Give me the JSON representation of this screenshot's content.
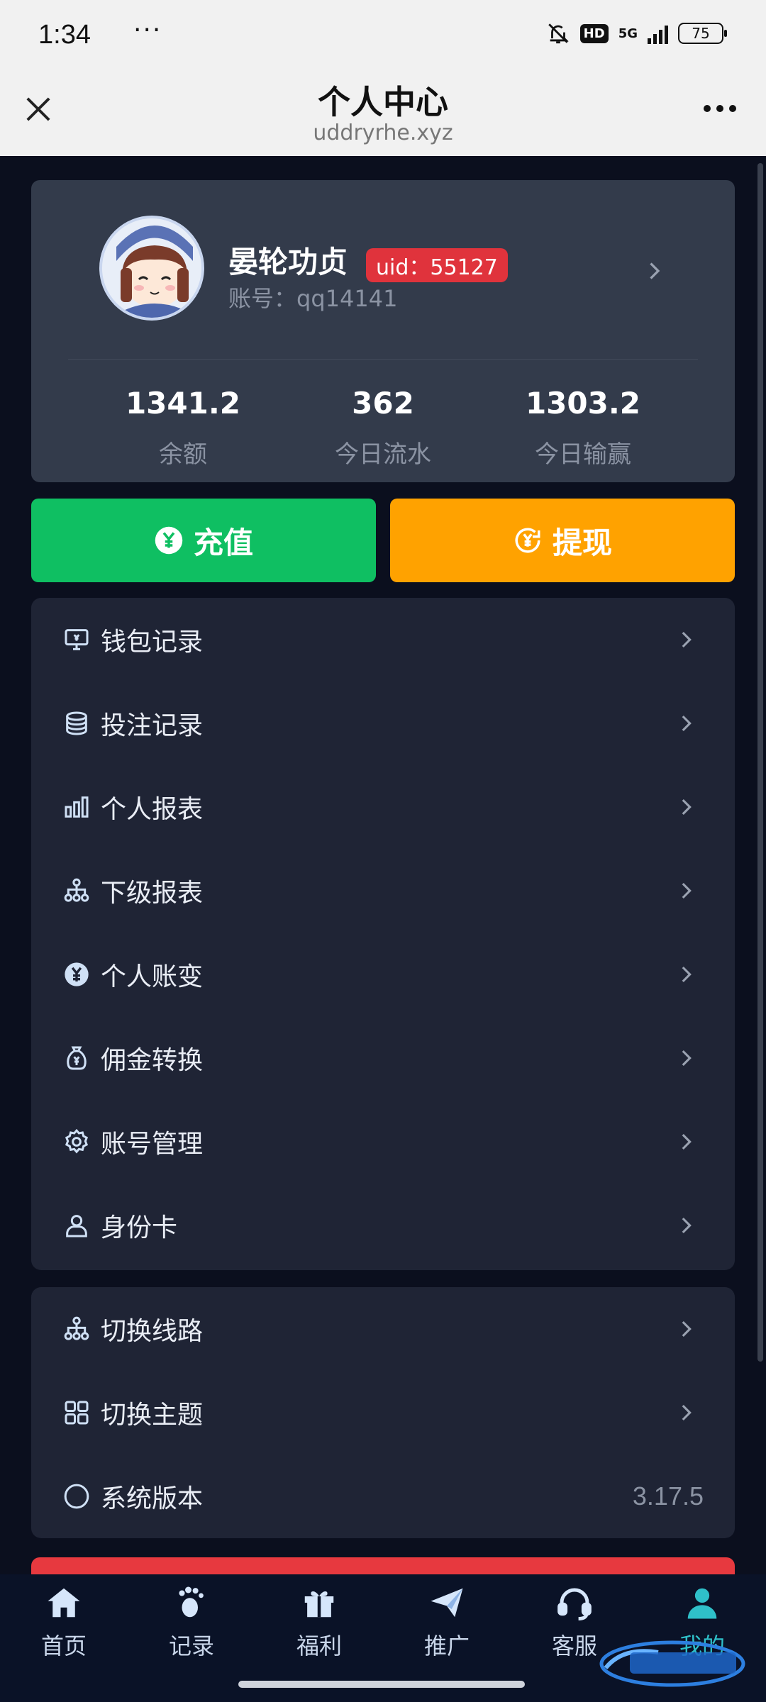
{
  "status_bar": {
    "time": "1:34",
    "dots": "···",
    "network": "5G",
    "battery": "75"
  },
  "header": {
    "title": "个人中心",
    "url": "uddryrhe.xyz"
  },
  "profile": {
    "name": "晏轮功贞",
    "uid_label": "uid：55127",
    "account_label": "账号：qq14141",
    "stats": [
      {
        "value": "1341.2",
        "label": "余额"
      },
      {
        "value": "362",
        "label": "今日流水"
      },
      {
        "value": "1303.2",
        "label": "今日输赢"
      }
    ]
  },
  "actions": {
    "recharge": "充值",
    "withdraw": "提现"
  },
  "menu_main": [
    {
      "label": "钱包记录",
      "icon": "wallet-monitor-icon"
    },
    {
      "label": "投注记录",
      "icon": "coin-stack-icon"
    },
    {
      "label": "个人报表",
      "icon": "bar-chart-icon"
    },
    {
      "label": "下级报表",
      "icon": "hierarchy-icon"
    },
    {
      "label": "个人账变",
      "icon": "yen-circle-icon"
    },
    {
      "label": "佣金转换",
      "icon": "money-bag-icon"
    },
    {
      "label": "账号管理",
      "icon": "gear-icon"
    },
    {
      "label": "身份卡",
      "icon": "user-icon"
    }
  ],
  "menu_system": [
    {
      "label": "切换线路",
      "icon": "hierarchy-icon"
    },
    {
      "label": "切换主题",
      "icon": "grid-icon"
    },
    {
      "label": "系统版本",
      "icon": "circle-icon",
      "value": "3.17.5"
    }
  ],
  "tabs": [
    {
      "label": "首页",
      "icon": "home-icon"
    },
    {
      "label": "记录",
      "icon": "footprint-icon"
    },
    {
      "label": "福利",
      "icon": "gift-icon"
    },
    {
      "label": "推广",
      "icon": "paper-plane-icon"
    },
    {
      "label": "客服",
      "icon": "headset-icon"
    },
    {
      "label": "我的",
      "icon": "person-icon",
      "active": true
    }
  ],
  "colors": {
    "recharge": "#0fbf62",
    "withdraw": "#ffa200",
    "uid_badge": "#e0333c",
    "active_tab": "#2fc0c9"
  }
}
